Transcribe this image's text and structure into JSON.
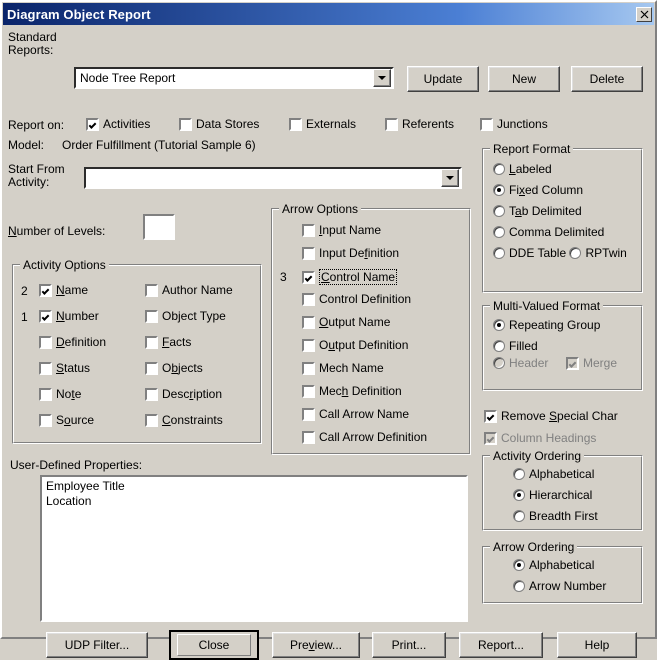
{
  "window": {
    "title": "Diagram Object Report",
    "close_icon": "close-icon"
  },
  "standard_reports": {
    "label_line1": "Standard",
    "label_line2": "Reports:",
    "selected": "Node Tree Report",
    "buttons": {
      "update": "Update",
      "new": "New",
      "delete": "Delete"
    }
  },
  "report_on": {
    "label": "Report on:",
    "options": [
      {
        "label": "Activities",
        "checked": true,
        "accel": "A"
      },
      {
        "label": "Data Stores",
        "checked": false,
        "accel": "D"
      },
      {
        "label": "Externals",
        "checked": false,
        "accel": "E"
      },
      {
        "label": "Referents",
        "checked": false,
        "accel": "R"
      },
      {
        "label": "Junctions",
        "checked": false,
        "accel": "J"
      }
    ]
  },
  "model": {
    "label": "Model:",
    "value": "Order Fulfillment (Tutorial Sample 6)"
  },
  "start_from": {
    "label_line1": "Start From",
    "label_line2": "Activity:",
    "value": ""
  },
  "number_of_levels": {
    "label": "Number of Levels:",
    "value": ""
  },
  "activity_options": {
    "legend": "Activity Options",
    "items": [
      {
        "label": "Name",
        "checked": true,
        "order": "2",
        "accel": "N"
      },
      {
        "label": "Number",
        "checked": true,
        "order": "1",
        "accel": "N"
      },
      {
        "label": "Definition",
        "checked": false,
        "order": "",
        "accel": "D"
      },
      {
        "label": "Status",
        "checked": false,
        "order": "",
        "accel": "S"
      },
      {
        "label": "Note",
        "checked": false,
        "order": "",
        "accel": "t"
      },
      {
        "label": "Source",
        "checked": false,
        "order": "",
        "accel": "o"
      }
    ],
    "items2": [
      {
        "label": "Author Name",
        "checked": false
      },
      {
        "label": "Object Type",
        "checked": false
      },
      {
        "label": "Facts",
        "checked": false
      },
      {
        "label": "Objects",
        "checked": false
      },
      {
        "label": "Description",
        "checked": false
      },
      {
        "label": "Constraints",
        "checked": false
      }
    ]
  },
  "arrow_options": {
    "legend": "Arrow Options",
    "items": [
      {
        "label": "Input Name",
        "checked": false,
        "order": "",
        "focused": false
      },
      {
        "label": "Input Definition",
        "checked": false,
        "order": "",
        "focused": false
      },
      {
        "label": "Control Name",
        "checked": true,
        "order": "3",
        "focused": true
      },
      {
        "label": "Control Definition",
        "checked": false,
        "order": "",
        "focused": false
      },
      {
        "label": "Output Name",
        "checked": false,
        "order": "",
        "focused": false
      },
      {
        "label": "Output Definition",
        "checked": false,
        "order": "",
        "focused": false
      },
      {
        "label": "Mech Name",
        "checked": false,
        "order": "",
        "focused": false
      },
      {
        "label": "Mech Definition",
        "checked": false,
        "order": "",
        "focused": false
      },
      {
        "label": "Call Arrow Name",
        "checked": false,
        "order": "",
        "focused": false
      },
      {
        "label": "Call Arrow Definition",
        "checked": false,
        "order": "",
        "focused": false
      }
    ]
  },
  "report_format": {
    "legend": "Report Format",
    "options": [
      {
        "label": "Labeled",
        "selected": false
      },
      {
        "label": "Fixed Column",
        "selected": true
      },
      {
        "label": "Tab Delimited",
        "selected": false
      },
      {
        "label": "Comma Delimited",
        "selected": false
      },
      {
        "label": "DDE Table",
        "selected": false
      },
      {
        "label": "RPTwin",
        "selected": false
      }
    ]
  },
  "multi_valued_format": {
    "legend": "Multi-Valued Format",
    "options": [
      {
        "label": "Repeating Group",
        "selected": true,
        "disabled": false
      },
      {
        "label": "Filled",
        "selected": false,
        "disabled": false
      },
      {
        "label": "Header",
        "selected": false,
        "disabled": true
      }
    ],
    "merge": {
      "label": "Merge",
      "checked": true,
      "disabled": true
    }
  },
  "special_options": {
    "remove_special_char": {
      "label": "Remove Special Char",
      "checked": true,
      "disabled": false
    },
    "column_headings": {
      "label": "Column Headings",
      "checked": true,
      "disabled": true
    }
  },
  "activity_ordering": {
    "legend": "Activity Ordering",
    "options": [
      {
        "label": "Alphabetical",
        "selected": false
      },
      {
        "label": "Hierarchical",
        "selected": true
      },
      {
        "label": "Breadth First",
        "selected": false
      }
    ]
  },
  "arrow_ordering": {
    "legend": "Arrow Ordering",
    "options": [
      {
        "label": "Alphabetical",
        "selected": true
      },
      {
        "label": "Arrow Number",
        "selected": false
      }
    ]
  },
  "udp": {
    "label": "User-Defined Properties:",
    "items": [
      "Employee Title",
      "Location"
    ]
  },
  "footer": {
    "buttons": [
      {
        "label": "UDP Filter...",
        "default": false
      },
      {
        "label": "Close",
        "default": true
      },
      {
        "label": "Preview...",
        "default": false
      },
      {
        "label": "Print...",
        "default": false
      },
      {
        "label": "Report...",
        "default": false
      },
      {
        "label": "Help",
        "default": false
      }
    ]
  }
}
